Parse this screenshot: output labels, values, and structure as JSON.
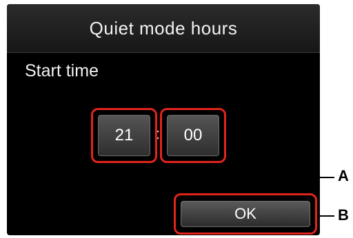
{
  "screen": {
    "title": "Quiet mode hours",
    "subtitle": "Start time",
    "time": {
      "hour": "21",
      "separator": ":",
      "minute": "00"
    },
    "ok_label": "OK"
  },
  "callouts": {
    "a_label": "A",
    "b_label": "B"
  },
  "colors": {
    "highlight": "#e3241d",
    "screen_background": "#000000"
  }
}
